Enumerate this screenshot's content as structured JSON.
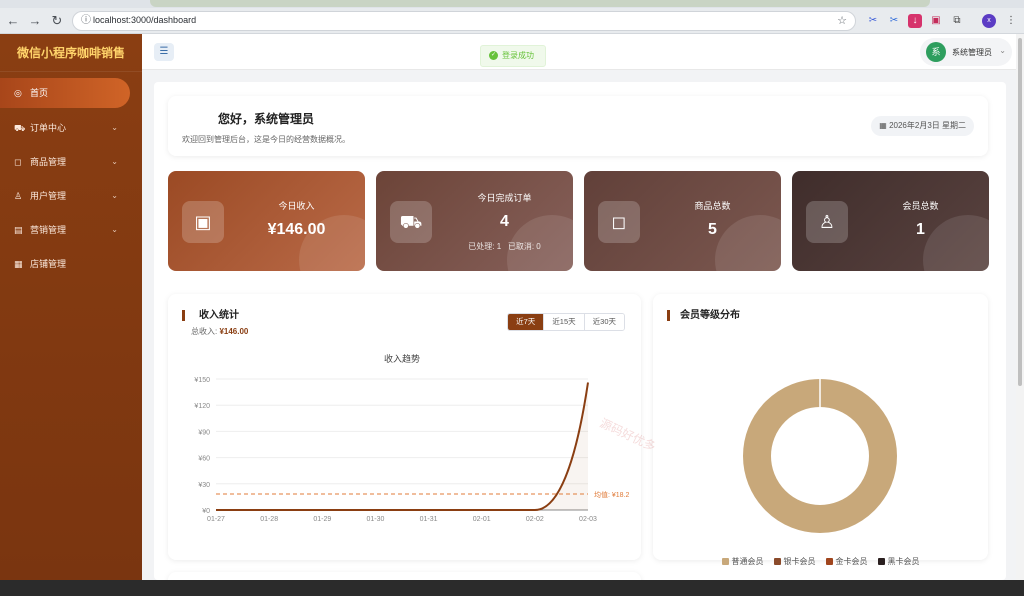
{
  "browser": {
    "url": "localhost:3000/dashboard",
    "profile_initial": "x"
  },
  "sidebar": {
    "brand": "微信小程序咖啡销售",
    "items": [
      {
        "label": "首页",
        "icon": "dashboard-icon",
        "active": true
      },
      {
        "label": "订单中心",
        "icon": "cart-icon",
        "chevron": true
      },
      {
        "label": "商品管理",
        "icon": "bag-icon",
        "chevron": true
      },
      {
        "label": "用户管理",
        "icon": "user-icon",
        "chevron": true
      },
      {
        "label": "营销管理",
        "icon": "chart-icon",
        "chevron": true
      },
      {
        "label": "店铺管理",
        "icon": "store-icon"
      }
    ]
  },
  "header": {
    "toast": "登录成功",
    "user_initial": "系",
    "user_name": "系统管理员"
  },
  "welcome": {
    "greeting": "您好，系统管理员",
    "subtitle": "欢迎回到管理后台，这是今日的经营数据概况。",
    "date": "2026年2月3日 星期二"
  },
  "stats": [
    {
      "label": "今日收入",
      "value": "¥146.00"
    },
    {
      "label": "今日完成订单",
      "value": "4",
      "sub_processed": "已处理: 1",
      "sub_cancelled": "已取消: 0"
    },
    {
      "label": "商品总数",
      "value": "5"
    },
    {
      "label": "会员总数",
      "value": "1"
    }
  ],
  "income_panel": {
    "title": "收入统计",
    "total_label": "总收入: ",
    "total_value": "¥146.00",
    "tabs": [
      "近7天",
      "近15天",
      "近30天"
    ],
    "active_tab": 0
  },
  "member_panel": {
    "title": "会员等级分布"
  },
  "chart_data": [
    {
      "type": "line",
      "title": "收入趋势",
      "x": [
        "01-27",
        "01-28",
        "01-29",
        "01-30",
        "01-31",
        "02-01",
        "02-02",
        "02-03"
      ],
      "series": [
        {
          "values": [
            0,
            0,
            0,
            0,
            0,
            0,
            0,
            146
          ],
          "color": "#8a3e12"
        }
      ],
      "ylim": [
        0,
        150
      ],
      "yticks": [
        "¥0",
        "¥30",
        "¥60",
        "¥90",
        "¥120",
        "¥150"
      ],
      "yticks_values": [
        0,
        30,
        60,
        90,
        120,
        150
      ],
      "average": {
        "value": 18.25,
        "label": "均值: ¥18.2",
        "color": "#e07b39"
      },
      "grid": true
    },
    {
      "type": "pie",
      "donut": true,
      "categories": [
        "普通会员",
        "银卡会员",
        "金卡会员",
        "黑卡会员"
      ],
      "values": [
        1,
        0,
        0,
        0
      ],
      "colors": [
        "#c8a87a",
        "#8a4a2a",
        "#a0451d",
        "#2a1f1f"
      ],
      "legend": "bottom"
    }
  ]
}
